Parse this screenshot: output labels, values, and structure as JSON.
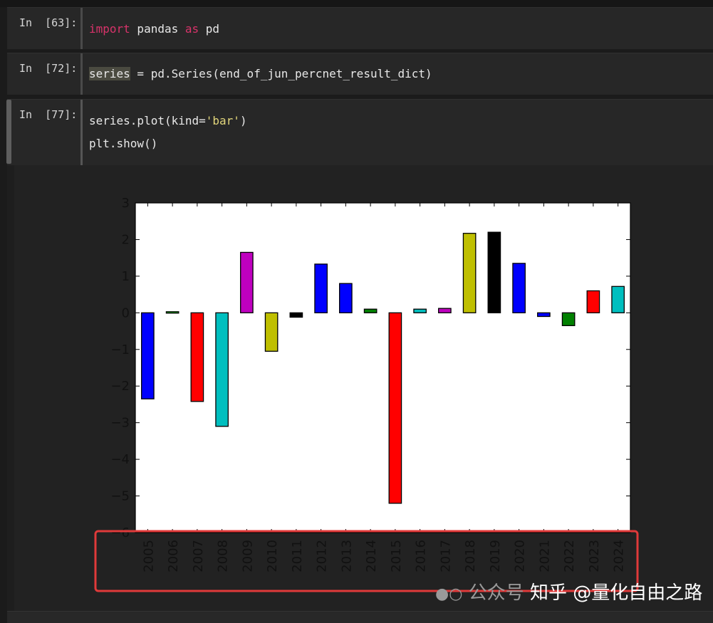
{
  "cells": [
    {
      "prompt": "In  [63]:",
      "tokens": [
        {
          "text": "import",
          "cls": "kw"
        },
        {
          "text": " pandas ",
          "cls": ""
        },
        {
          "text": "as",
          "cls": "kw"
        },
        {
          "text": " pd",
          "cls": ""
        }
      ]
    },
    {
      "prompt": "In  [72]:",
      "tokens": [
        {
          "text": "series",
          "cls": "hl"
        },
        {
          "text": " = pd.Series(end_of_jun_percnet_result_dict)",
          "cls": ""
        }
      ]
    },
    {
      "prompt": "In  [77]:",
      "line1": [
        {
          "text": "series.plot(kind=",
          "cls": ""
        },
        {
          "text": "'bar'",
          "cls": "str"
        },
        {
          "text": ")",
          "cls": ""
        }
      ],
      "line2": [
        {
          "text": "plt.show()",
          "cls": ""
        }
      ]
    }
  ],
  "chart_data": {
    "type": "bar",
    "categories": [
      "2005",
      "2006",
      "2007",
      "2008",
      "2009",
      "2010",
      "2011",
      "2012",
      "2013",
      "2014",
      "2015",
      "2016",
      "2017",
      "2018",
      "2019",
      "2020",
      "2021",
      "2022",
      "2023",
      "2024"
    ],
    "values": [
      -2.35,
      0.03,
      -2.42,
      -3.1,
      1.65,
      -1.05,
      -0.12,
      1.33,
      0.8,
      0.1,
      -5.2,
      0.1,
      0.12,
      2.17,
      2.2,
      1.35,
      -0.1,
      -0.35,
      0.6,
      0.72
    ],
    "colors": [
      "#0000ff",
      "#00bf00",
      "#ff0000",
      "#00bfbf",
      "#bf00bf",
      "#bfbf00",
      "#000000",
      "#0000ff",
      "#0000ff",
      "#008000",
      "#ff0000",
      "#00bfbf",
      "#bf00bf",
      "#bfbf00",
      "#000000",
      "#0000ff",
      "#0000ff",
      "#008000",
      "#ff0000",
      "#00bfbf"
    ],
    "yticks": [
      "3",
      "2",
      "1",
      "0",
      "−1",
      "−2",
      "−3",
      "−4",
      "−5",
      "−6"
    ],
    "ylim": [
      -6,
      3
    ],
    "highlight_color": "#e03a3a"
  },
  "watermark": {
    "platform": "公众号",
    "zhihu": "知乎",
    "handle": "@量化自由之路"
  }
}
